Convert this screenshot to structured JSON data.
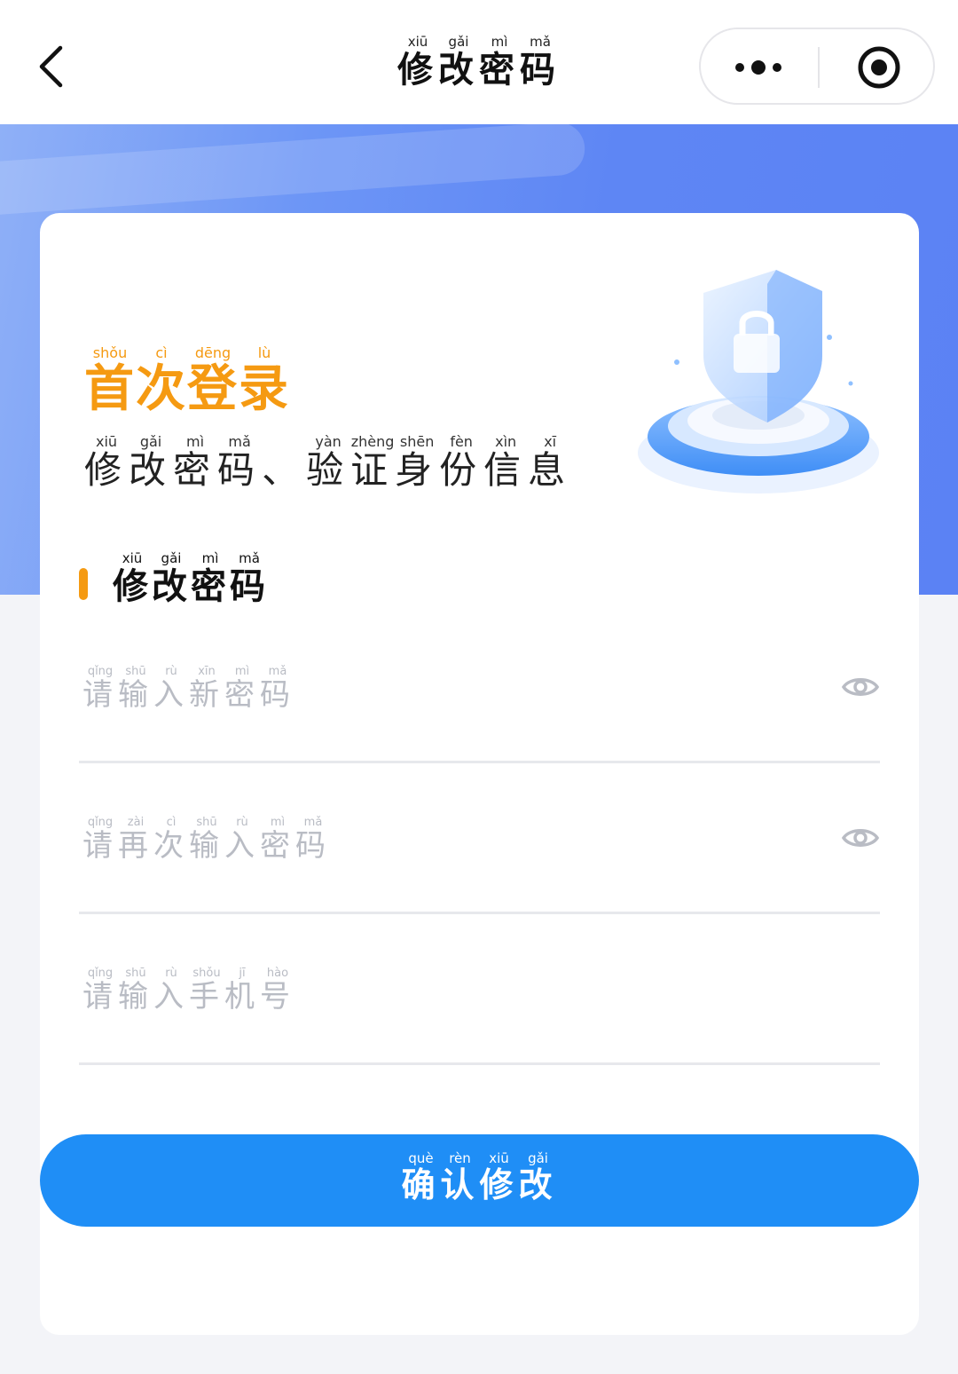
{
  "navbar": {
    "title": [
      {
        "char": "修",
        "pinyin": "xiū"
      },
      {
        "char": "改",
        "pinyin": "gǎi"
      },
      {
        "char": "密",
        "pinyin": "mì"
      },
      {
        "char": "码",
        "pinyin": "mǎ"
      }
    ],
    "back_icon": "chevron-left-icon",
    "more_icon": "more-dots-icon",
    "close_icon": "target-close-icon"
  },
  "colors": {
    "accent_orange": "#f59a12",
    "primary_blue": "#1f8ef6",
    "banner_blue": "#5e86f4",
    "placeholder_gray": "#b9bcc4"
  },
  "hero": {
    "headline": [
      {
        "char": "首",
        "pinyin": "shǒu"
      },
      {
        "char": "次",
        "pinyin": "cì"
      },
      {
        "char": "登",
        "pinyin": "dēng"
      },
      {
        "char": "录",
        "pinyin": "lù"
      }
    ],
    "subheadline": [
      {
        "char": "修",
        "pinyin": "xiū"
      },
      {
        "char": "改",
        "pinyin": "gǎi"
      },
      {
        "char": "密",
        "pinyin": "mì"
      },
      {
        "char": "码",
        "pinyin": "mǎ"
      },
      {
        "char": "、",
        "pinyin": ""
      },
      {
        "char": "验",
        "pinyin": "yàn"
      },
      {
        "char": "证",
        "pinyin": "zhèng"
      },
      {
        "char": "身",
        "pinyin": "shēn"
      },
      {
        "char": "份",
        "pinyin": "fèn"
      },
      {
        "char": "信",
        "pinyin": "xìn"
      },
      {
        "char": "息",
        "pinyin": "xī"
      }
    ],
    "illustration_icon": "shield-lock-icon"
  },
  "section": {
    "title": [
      {
        "char": "修",
        "pinyin": "xiū"
      },
      {
        "char": "改",
        "pinyin": "gǎi"
      },
      {
        "char": "密",
        "pinyin": "mì"
      },
      {
        "char": "码",
        "pinyin": "mǎ"
      }
    ]
  },
  "form": {
    "fields": [
      {
        "name": "new-password-input",
        "placeholder": [
          {
            "char": "请",
            "pinyin": "qǐng"
          },
          {
            "char": "输",
            "pinyin": "shū"
          },
          {
            "char": "入",
            "pinyin": "rù"
          },
          {
            "char": "新",
            "pinyin": "xīn"
          },
          {
            "char": "密",
            "pinyin": "mì"
          },
          {
            "char": "码",
            "pinyin": "mǎ"
          }
        ],
        "has_eye": true
      },
      {
        "name": "confirm-password-input",
        "placeholder": [
          {
            "char": "请",
            "pinyin": "qǐng"
          },
          {
            "char": "再",
            "pinyin": "zài"
          },
          {
            "char": "次",
            "pinyin": "cì"
          },
          {
            "char": "输",
            "pinyin": "shū"
          },
          {
            "char": "入",
            "pinyin": "rù"
          },
          {
            "char": "密",
            "pinyin": "mì"
          },
          {
            "char": "码",
            "pinyin": "mǎ"
          }
        ],
        "has_eye": true
      },
      {
        "name": "phone-number-input",
        "placeholder": [
          {
            "char": "请",
            "pinyin": "qǐng"
          },
          {
            "char": "输",
            "pinyin": "shū"
          },
          {
            "char": "入",
            "pinyin": "rù"
          },
          {
            "char": "手",
            "pinyin": "shǒu"
          },
          {
            "char": "机",
            "pinyin": "jī"
          },
          {
            "char": "号",
            "pinyin": "hào"
          }
        ],
        "has_eye": false
      }
    ],
    "eye_icon": "eye-icon",
    "submit": [
      {
        "char": "确",
        "pinyin": "què"
      },
      {
        "char": "认",
        "pinyin": "rèn"
      },
      {
        "char": "修",
        "pinyin": "xiū"
      },
      {
        "char": "改",
        "pinyin": "gǎi"
      }
    ]
  }
}
